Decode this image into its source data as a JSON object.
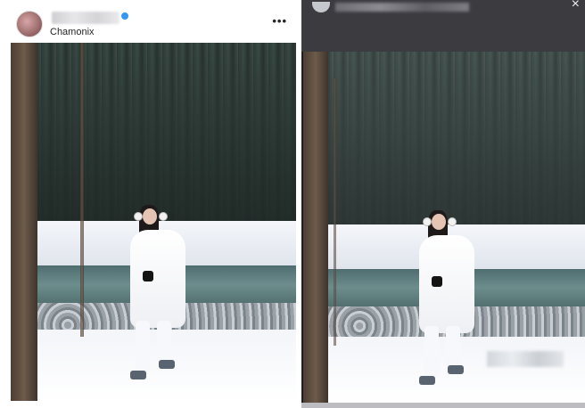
{
  "post": {
    "location": "Chamonix",
    "more_label": "•••"
  },
  "viewer": {
    "close_label": "×"
  },
  "icons": {
    "more": "more-horizontal-icon",
    "close": "close-icon",
    "verified": "verified-badge-icon"
  },
  "colors": {
    "verified": "#3897f0",
    "viewer_bar": "#3b3b40",
    "viewer_bg": "#1f1f22"
  }
}
